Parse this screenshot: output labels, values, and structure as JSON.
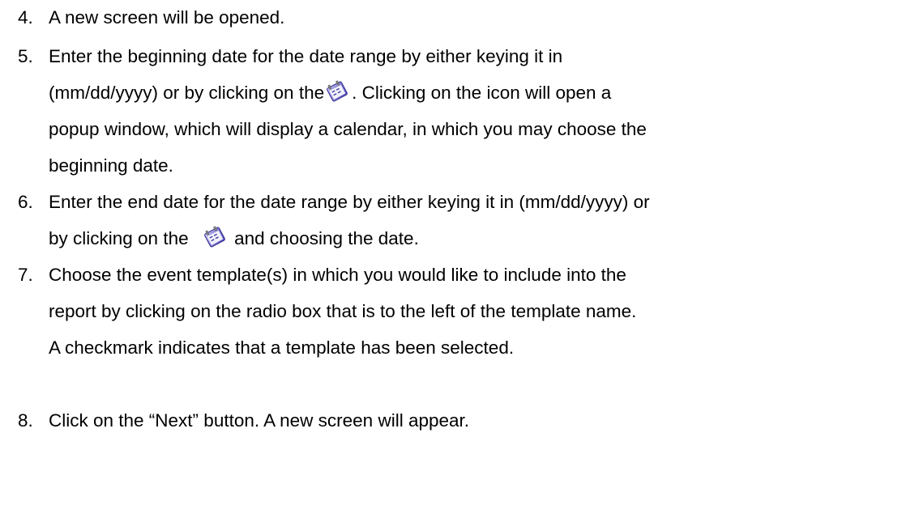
{
  "steps": [
    {
      "number": "4.",
      "lines": [
        "A new screen will be opened."
      ]
    },
    {
      "number": "5.",
      "line1": "Enter the beginning date for the date range by either keying it in",
      "line2_before": "(mm/dd/yyyy) or by clicking on the",
      "line2_after": ". Clicking on the icon will open a",
      "line3": "popup window, which will display a calendar, in which you may choose the",
      "line4": "beginning date."
    },
    {
      "number": "6.",
      "line1": "Enter the end date for the date range by either keying it in (mm/dd/yyyy) or",
      "line2_before": "by clicking on the",
      "line2_after": "and choosing the date."
    },
    {
      "number": "7.",
      "line1": "Choose the event template(s) in which you would like to include into the",
      "line2": "report by clicking on the radio box that is to the left of the template name.",
      "line3": "A checkmark indicates that a template has been selected."
    },
    {
      "number": "8.",
      "line1": "Click on the “Next” button. A new screen will appear."
    }
  ],
  "icons": {
    "calendar": "calendar-icon"
  }
}
